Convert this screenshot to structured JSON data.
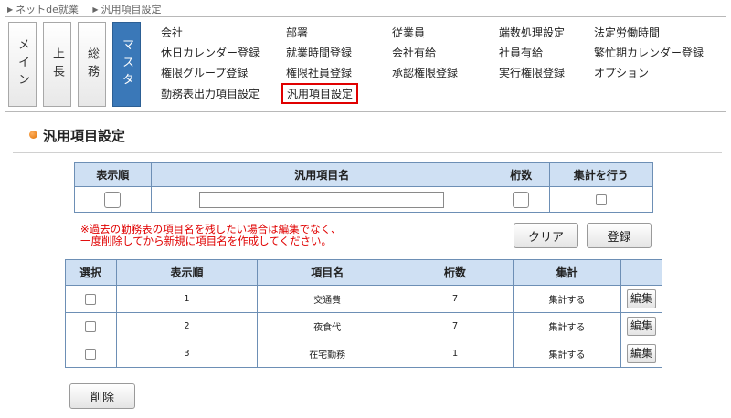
{
  "breadcrumb": [
    "ネットde就業",
    "汎用項目設定"
  ],
  "nav": {
    "tabs": [
      {
        "label": "メイン",
        "active": false
      },
      {
        "label": "上長",
        "active": false
      },
      {
        "label": "総務",
        "active": false
      },
      {
        "label": "マスタ",
        "active": true
      }
    ],
    "links": [
      "会社",
      "部署",
      "従業員",
      "端数処理設定",
      "法定労働時間",
      "休日カレンダー登録",
      "就業時間登録",
      "会社有給",
      "社員有給",
      "繁忙期カレンダー登録",
      "権限グループ登録",
      "権限社員登録",
      "承認権限登録",
      "実行権限登録",
      "オプション",
      "勤務表出力項目設定",
      "汎用項目設定"
    ],
    "highlighted_link": "汎用項目設定"
  },
  "section": {
    "title": "汎用項目設定"
  },
  "form_table": {
    "headers": [
      "表示順",
      "汎用項目名",
      "桁数",
      "集計を行う"
    ]
  },
  "notice": {
    "line1": "※過去の勤務表の項目名を残したい場合は編集でなく、",
    "line2": "一度削除してから新規に項目名を作成してください。"
  },
  "buttons": {
    "clear": "クリア",
    "register": "登録",
    "delete": "削除",
    "edit": "編集"
  },
  "list_table": {
    "headers": [
      "選択",
      "表示順",
      "項目名",
      "桁数",
      "集計"
    ],
    "rows": [
      {
        "order": "1",
        "name": "交通費",
        "digits": "7",
        "aggregate": "集計する"
      },
      {
        "order": "2",
        "name": "夜食代",
        "digits": "7",
        "aggregate": "集計する"
      },
      {
        "order": "3",
        "name": "在宅勤務",
        "digits": "1",
        "aggregate": "集計する"
      }
    ]
  },
  "colors": {
    "accent": "#3a78b8",
    "header_bg": "#cfe0f3",
    "alert": "#e00000",
    "highlight_border": "#e00000"
  },
  "icons": {
    "breadcrumb_marker": "triangle-right-icon",
    "section_bullet": "orange-dot-icon"
  }
}
